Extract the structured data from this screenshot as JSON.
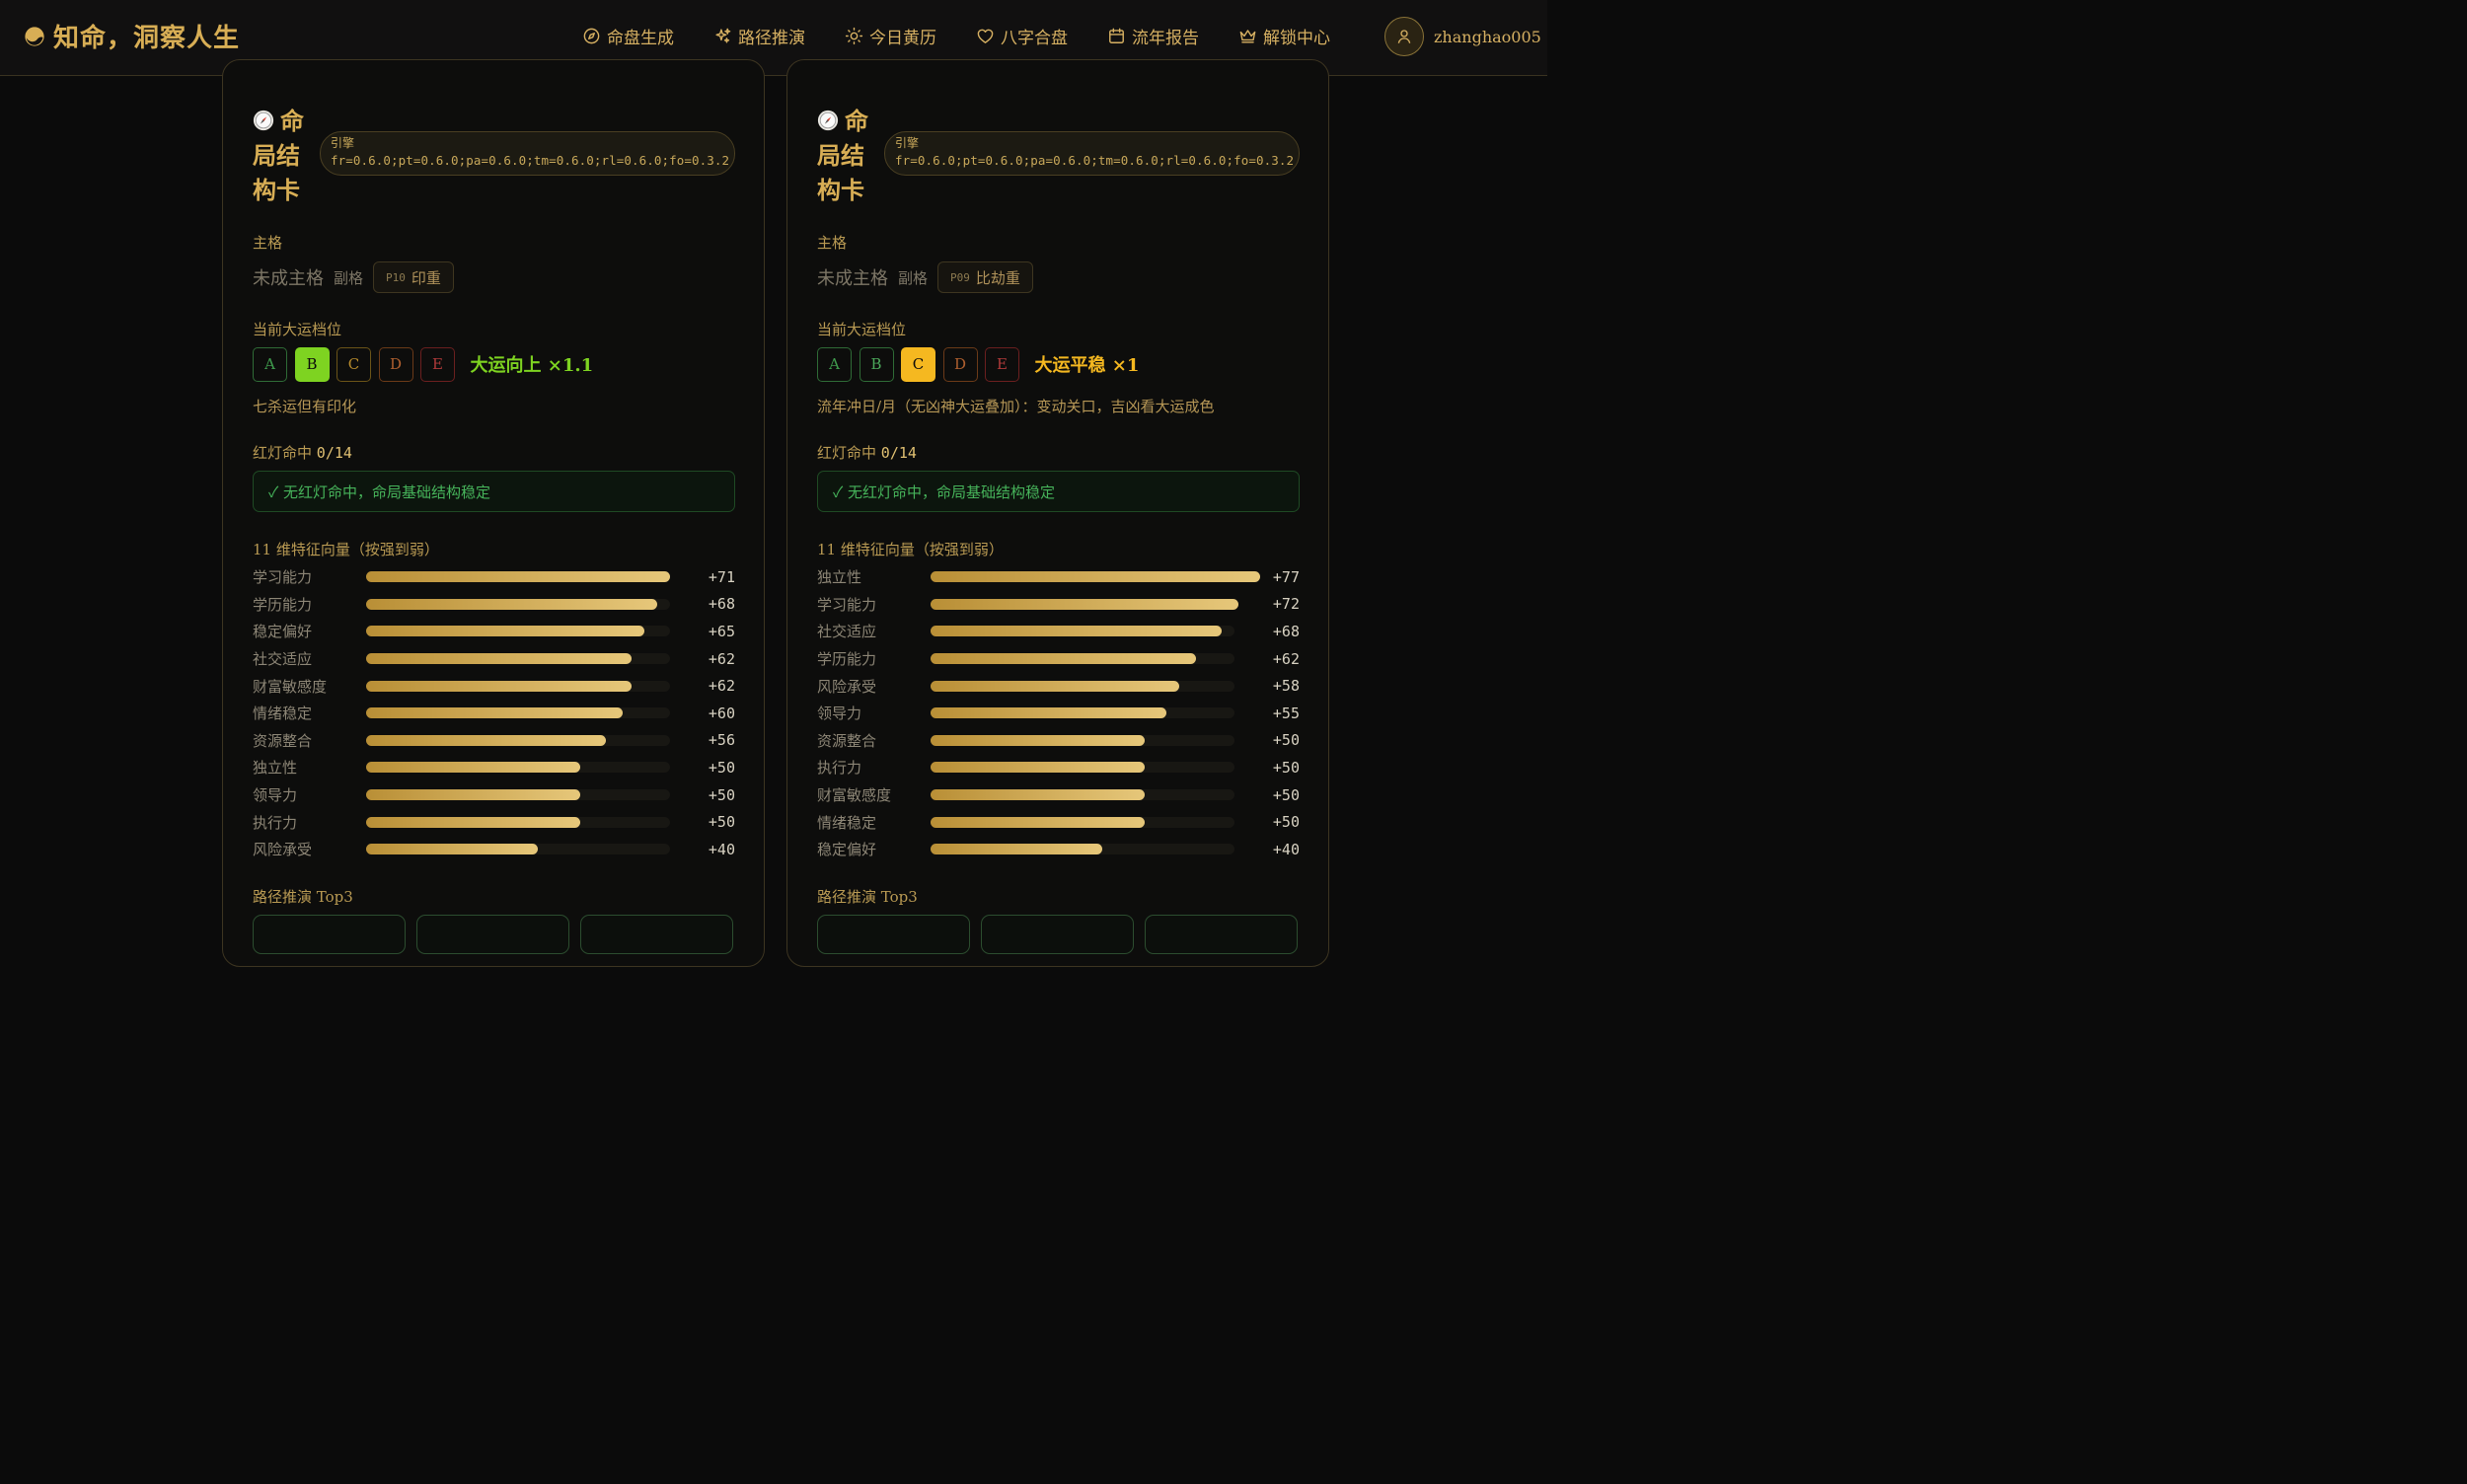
{
  "header": {
    "brand": "知命，洞察人生",
    "nav": [
      {
        "label": "命盘生成",
        "icon": "compass-icon"
      },
      {
        "label": "路径推演",
        "icon": "sparkles-icon"
      },
      {
        "label": "今日黄历",
        "icon": "sun-icon"
      },
      {
        "label": "八字合盘",
        "icon": "heart-icon"
      },
      {
        "label": "流年报告",
        "icon": "calendar-icon"
      },
      {
        "label": "解锁中心",
        "icon": "crown-icon"
      }
    ],
    "username": "zhanghao005"
  },
  "colors": {
    "accent": "#d6b062",
    "background": "#0b0b0b",
    "success": "#46b35a"
  },
  "cards": [
    {
      "title": "命局结构卡",
      "engine_label": "引擎",
      "engine_value": "fr=0.6.0;pt=0.6.0;pa=0.6.0;tm=0.6.0;rl=0.6.0;fo=0.3.2",
      "main_label": "主格",
      "main_value": "未成主格",
      "sub_label": "副格",
      "sub_code": "P10",
      "sub_name": "印重",
      "grade_label": "当前大运档位",
      "grades": [
        "A",
        "B",
        "C",
        "D",
        "E"
      ],
      "active_grade": "B",
      "grade_status": "大运向上 ×1.1",
      "grade_note": "七杀运但有印化",
      "redlight_label": "红灯命中",
      "redlight_count": "0/14",
      "ok_message": "✓ 无红灯命中，命局基础结构稳定",
      "vector_title": "11 维特征向量（按强到弱）",
      "vectors": [
        {
          "name": "学习能力",
          "value": 71,
          "label": "+71"
        },
        {
          "name": "学历能力",
          "value": 68,
          "label": "+68"
        },
        {
          "name": "稳定偏好",
          "value": 65,
          "label": "+65"
        },
        {
          "name": "社交适应",
          "value": 62,
          "label": "+62"
        },
        {
          "name": "财富敏感度",
          "value": 62,
          "label": "+62"
        },
        {
          "name": "情绪稳定",
          "value": 60,
          "label": "+60"
        },
        {
          "name": "资源整合",
          "value": 56,
          "label": "+56"
        },
        {
          "name": "独立性",
          "value": 50,
          "label": "+50"
        },
        {
          "name": "领导力",
          "value": 50,
          "label": "+50"
        },
        {
          "name": "执行力",
          "value": 50,
          "label": "+50"
        },
        {
          "name": "风险承受",
          "value": 40,
          "label": "+40"
        }
      ],
      "path_title": "路径推演 Top3"
    },
    {
      "title": "命局结构卡",
      "engine_label": "引擎",
      "engine_value": "fr=0.6.0;pt=0.6.0;pa=0.6.0;tm=0.6.0;rl=0.6.0;fo=0.3.2",
      "main_label": "主格",
      "main_value": "未成主格",
      "sub_label": "副格",
      "sub_code": "P09",
      "sub_name": "比劫重",
      "grade_label": "当前大运档位",
      "grades": [
        "A",
        "B",
        "C",
        "D",
        "E"
      ],
      "active_grade": "C",
      "grade_status": "大运平稳 ×1",
      "grade_note": "流年冲日/月（无凶神大运叠加）：变动关口，吉凶看大运成色",
      "redlight_label": "红灯命中",
      "redlight_count": "0/14",
      "ok_message": "✓ 无红灯命中，命局基础结构稳定",
      "vector_title": "11 维特征向量（按强到弱）",
      "vectors": [
        {
          "name": "独立性",
          "value": 77,
          "label": "+77"
        },
        {
          "name": "学习能力",
          "value": 72,
          "label": "+72"
        },
        {
          "name": "社交适应",
          "value": 68,
          "label": "+68"
        },
        {
          "name": "学历能力",
          "value": 62,
          "label": "+62"
        },
        {
          "name": "风险承受",
          "value": 58,
          "label": "+58"
        },
        {
          "name": "领导力",
          "value": 55,
          "label": "+55"
        },
        {
          "name": "资源整合",
          "value": 50,
          "label": "+50"
        },
        {
          "name": "执行力",
          "value": 50,
          "label": "+50"
        },
        {
          "name": "财富敏感度",
          "value": 50,
          "label": "+50"
        },
        {
          "name": "情绪稳定",
          "value": 50,
          "label": "+50"
        },
        {
          "name": "稳定偏好",
          "value": 40,
          "label": "+40"
        }
      ],
      "path_title": "路径推演 Top3"
    }
  ]
}
